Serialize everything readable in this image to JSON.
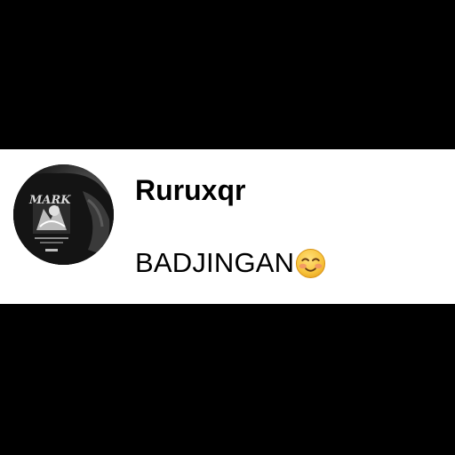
{
  "comment": {
    "username": "Ruruxqr",
    "message": "BADJINGAN",
    "emoji": "smiling-face-with-smiling-eyes-icon",
    "avatar_shirt_print": "MARK"
  },
  "colors": {
    "background": "#000000",
    "card": "#ffffff",
    "text": "#000000",
    "emoji_face": "#f7c23a",
    "emoji_blush": "#f08a6a"
  }
}
